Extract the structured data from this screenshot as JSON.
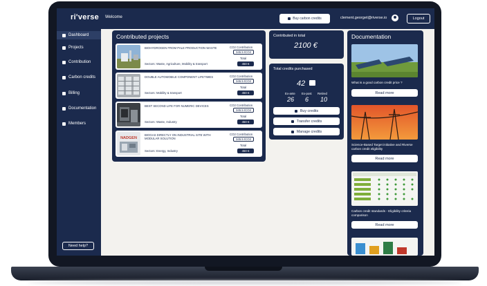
{
  "app": {
    "logo": "ri'verse",
    "welcome": "Welcome",
    "buy_button": "Buy carbon credits",
    "user_email": "clement.georget@riverse.io",
    "logout": "Logout"
  },
  "sidebar": {
    "items": [
      {
        "label": "Dashboard",
        "icon": "grid-icon"
      },
      {
        "label": "Projects",
        "icon": "document-icon"
      },
      {
        "label": "Contribution",
        "icon": "chart-icon"
      },
      {
        "label": "Carbon credits",
        "icon": "leaf-icon"
      },
      {
        "label": "Billing",
        "icon": "receipt-icon"
      },
      {
        "label": "Documentation",
        "icon": "book-icon"
      },
      {
        "label": "Members",
        "icon": "user-icon"
      }
    ],
    "help": "Need help?"
  },
  "projects": {
    "title": "Contributed projects",
    "co2_label": "CO2 Contribution",
    "total_label": "Total",
    "items": [
      {
        "name": "BIOHYDROGEN FROM PALE PRODUCTION WASTE",
        "sector": "Sectors: Waste, Agriculture, Mobility & transport",
        "co2": "345.5 tCO2",
        "total": "450 €",
        "thumb": "solar"
      },
      {
        "name": "DOUBLE AUTOMOBILE COMPONENT LIFETIMES",
        "sector": "Sectors: Mobility & transport",
        "co2": "345.5 tCO2",
        "total": "450 €",
        "thumb": "panels"
      },
      {
        "name": "BEST SECOND LIFE FOR NUMERIC DEVICES",
        "sector": "Sectors: Waste, Industry",
        "co2": "345.5 tCO2",
        "total": "450 €",
        "thumb": "devices"
      },
      {
        "name": "BIOGAS DIRECTLY ON INDUSTRIAL SITE WITH MODULAR SOLUTION",
        "sector": "Sectors: Energy, Industry",
        "co2": "345.5 tCO2",
        "total": "450 €",
        "thumb": "nadgen",
        "thumb_text": "NADGEN"
      }
    ]
  },
  "contributed": {
    "title": "Contributed in total",
    "value": "2100 €"
  },
  "credits": {
    "title": "Total credits purchased",
    "total": "42",
    "stats": [
      {
        "label": "Ex-ante",
        "value": "26"
      },
      {
        "label": "Ex-post",
        "value": "6"
      },
      {
        "label": "Retired",
        "value": "10"
      }
    ],
    "actions": [
      "Buy credits",
      "Transfer credits",
      "Manage credits"
    ]
  },
  "documentation": {
    "title": "Documentation",
    "read_more": "Read more",
    "items": [
      {
        "title": "What is a good carbon credit price ?"
      },
      {
        "title": "Science-Based Target initiative and Riverse carbon credit eligibility"
      },
      {
        "title": "Carbon credit standards - Eligibility criteria comparison"
      }
    ]
  }
}
